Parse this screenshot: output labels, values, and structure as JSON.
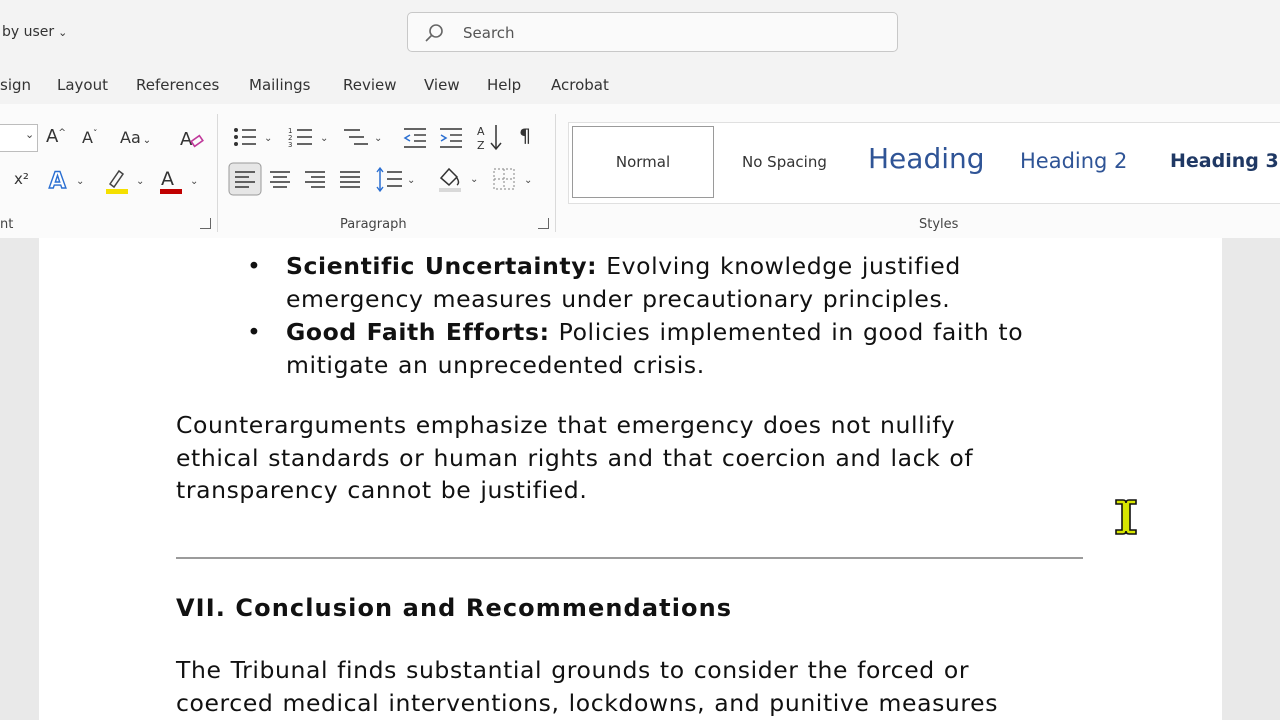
{
  "titlebar": {
    "user_label": "by user",
    "search_placeholder": "Search"
  },
  "menu": {
    "items": [
      "sign",
      "Layout",
      "References",
      "Mailings",
      "Review",
      "View",
      "Help",
      "Acrobat"
    ]
  },
  "ribbon": {
    "groups": {
      "font_label": "nt",
      "paragraph_label": "Paragraph",
      "styles_label": "Styles"
    },
    "font": {
      "grow_label": "A",
      "shrink_label": "A",
      "case_label": "Aa",
      "superscript_label": "x²"
    },
    "styles": [
      "Normal",
      "No Spacing",
      "Heading",
      "Heading 2",
      "Heading 3"
    ],
    "colors": {
      "highlight": "#f5e000",
      "font_color": "#c00000",
      "text_effect": "#2b6fd1",
      "heading": "#2f5496"
    }
  },
  "document": {
    "bullets": [
      {
        "bold": "Scientific Uncertainty:",
        "line1": " Evolving knowledge justified",
        "line2": "emergency measures under precautionary principles."
      },
      {
        "bold": "Good Faith Efforts:",
        "line1": " Policies implemented in good faith to",
        "line2": "mitigate an unprecedented crisis."
      }
    ],
    "counter_para": [
      "Counterarguments emphasize that emergency does not nullify",
      "ethical standards or human rights and that coercion and lack of",
      "transparency cannot be justified."
    ],
    "section_heading": "VII. Conclusion and Recommendations",
    "conclusion_para": [
      "The Tribunal finds substantial grounds to consider the forced or",
      "coerced medical interventions, lockdowns, and punitive measures"
    ]
  }
}
